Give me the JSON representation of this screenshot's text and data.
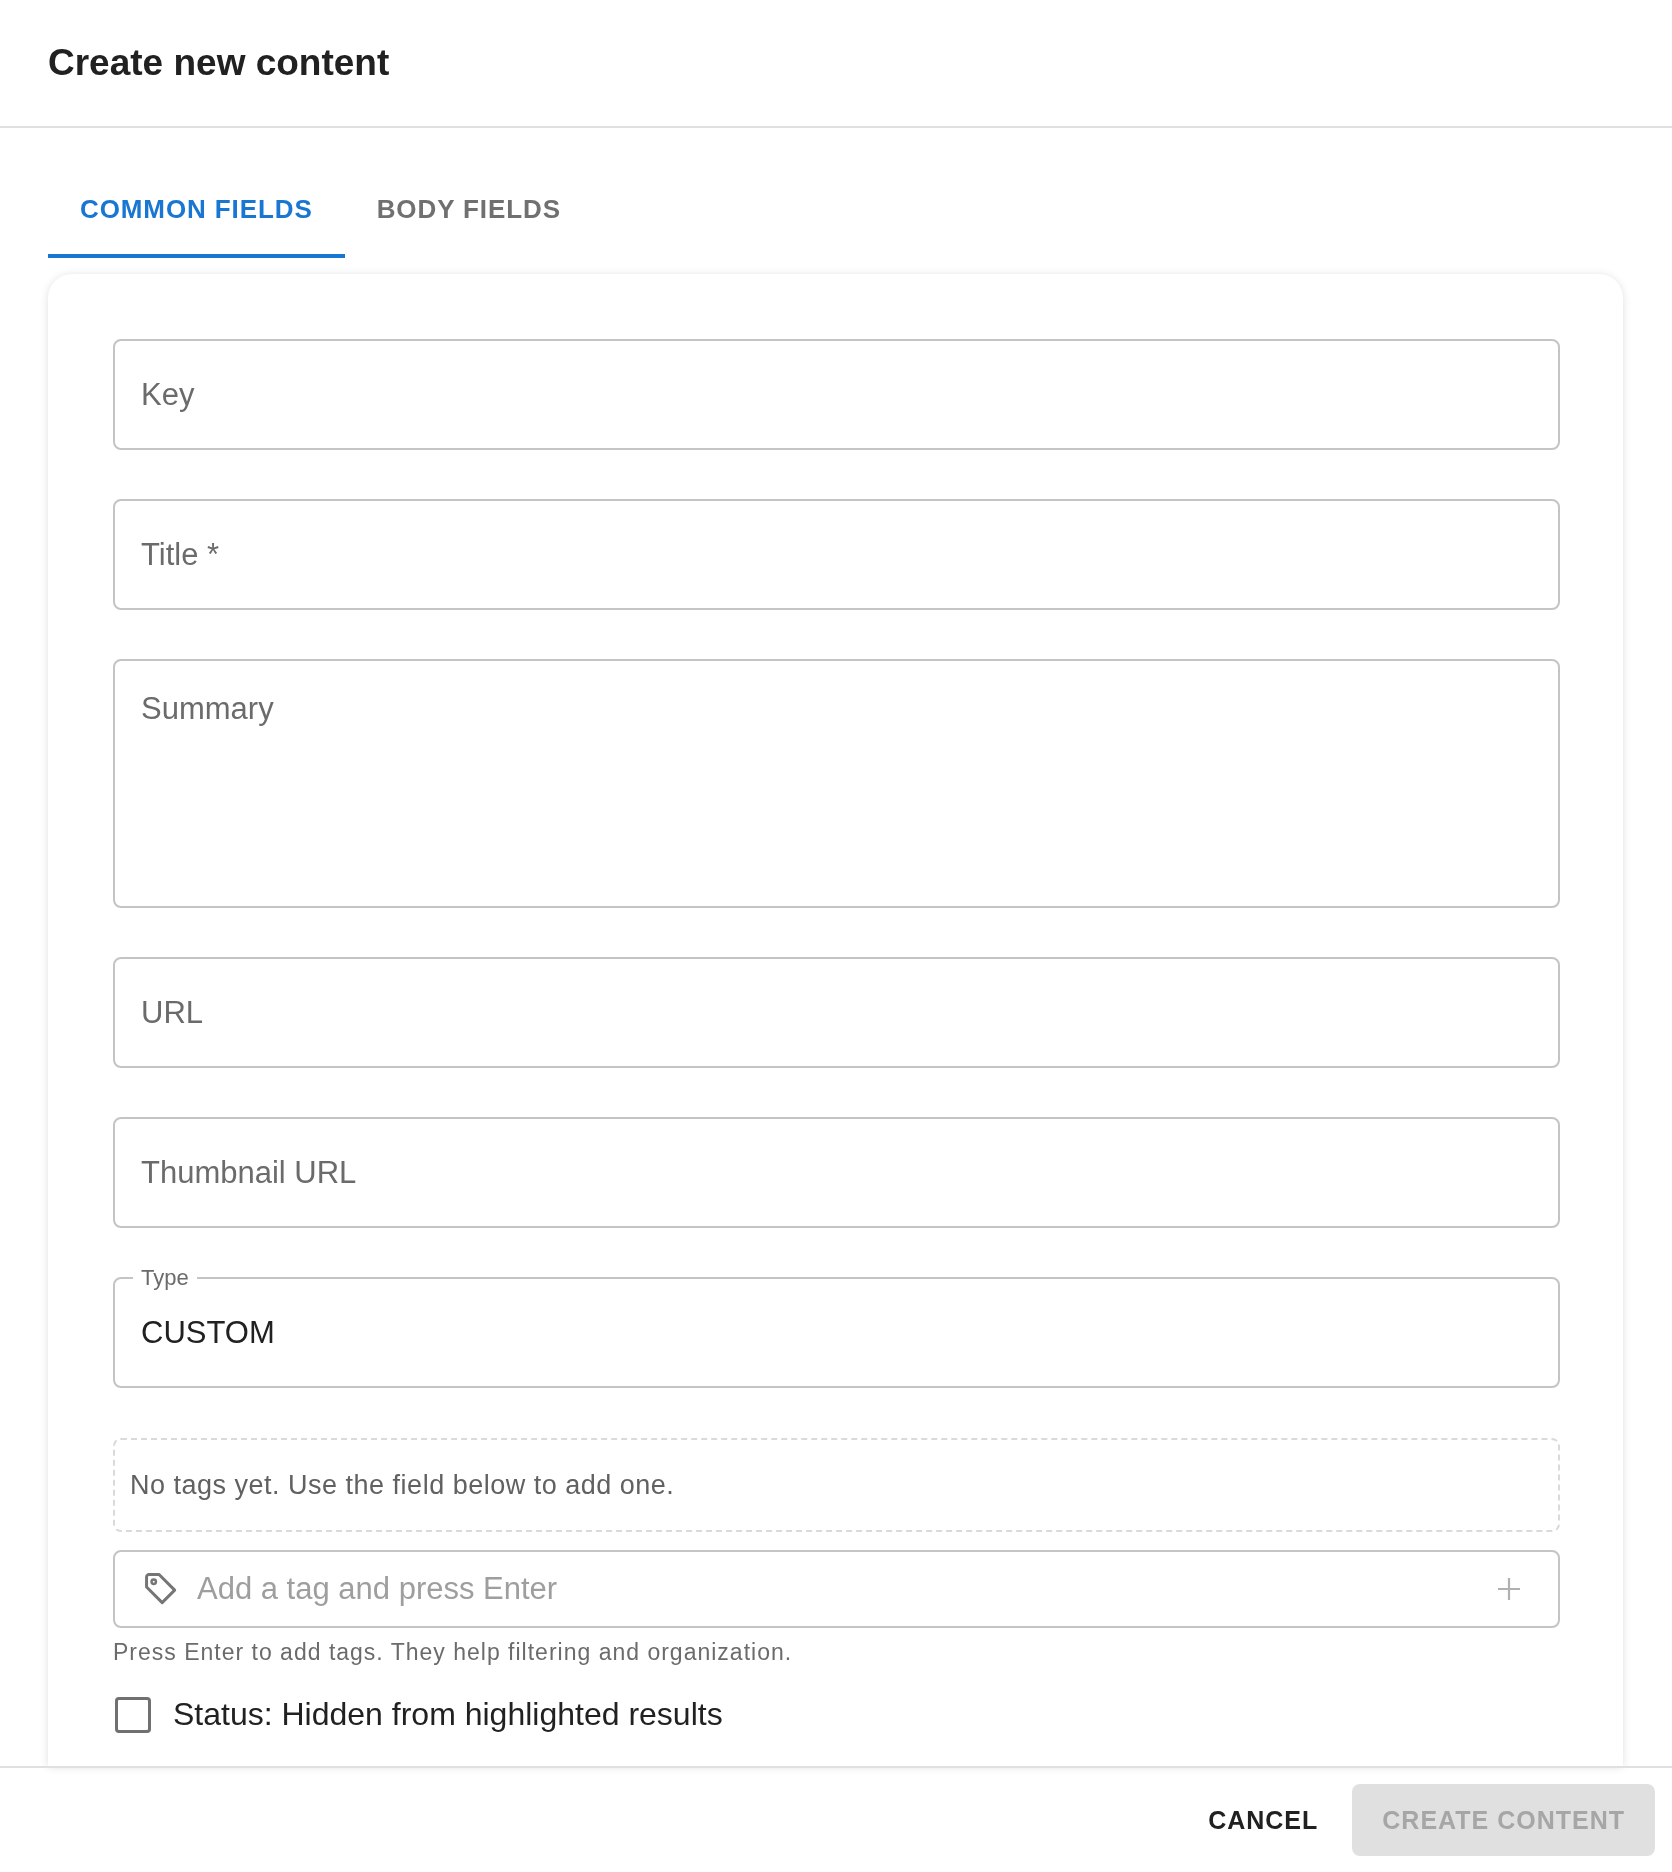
{
  "dialog": {
    "title": "Create new content"
  },
  "tabs": [
    {
      "label": "COMMON FIELDS",
      "selected": true
    },
    {
      "label": "BODY FIELDS",
      "selected": false
    }
  ],
  "form": {
    "fields": [
      {
        "kind": "input",
        "placeholder": "Key"
      },
      {
        "kind": "input",
        "placeholder": "Title *"
      },
      {
        "kind": "textarea",
        "placeholder": "Summary"
      },
      {
        "kind": "input",
        "placeholder": "URL"
      },
      {
        "kind": "input",
        "placeholder": "Thumbnail URL"
      },
      {
        "kind": "input",
        "label": "Type",
        "value": "CUSTOM"
      }
    ],
    "tags": {
      "empty_message": "No tags yet. Use the field below to add one.",
      "input": {
        "placeholder": "Add a tag and press Enter"
      },
      "helper": "Press Enter to add tags. They help filtering and organization."
    },
    "status_checkbox": {
      "label": "Status: Hidden from highlighted results",
      "checked": false
    }
  },
  "actions": [
    {
      "kind": "cancel",
      "label": "CANCEL",
      "disabled": false
    },
    {
      "kind": "submit",
      "label": "CREATE CONTENT",
      "disabled": true
    }
  ]
}
